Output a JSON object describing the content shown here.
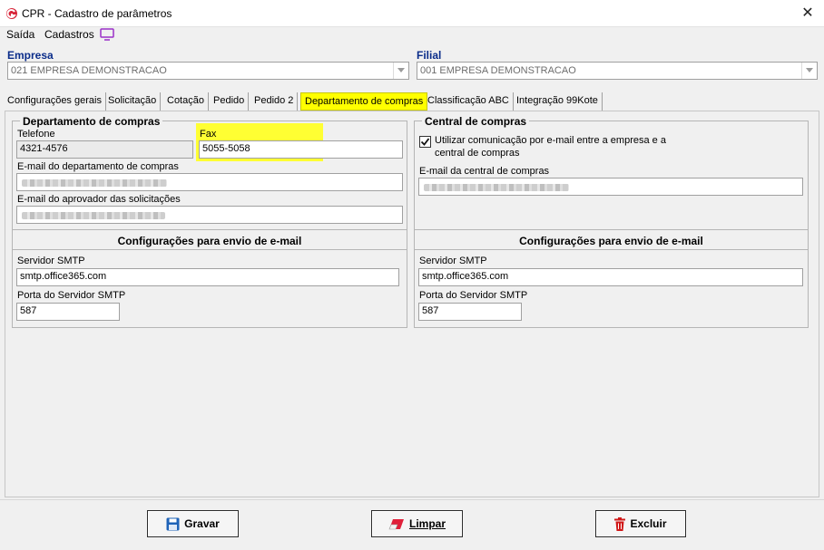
{
  "window": {
    "title": "CPR - Cadastro de parâmetros",
    "close_symbol": "✕"
  },
  "menu": {
    "items": [
      "Saída",
      "Cadastros"
    ]
  },
  "empresa": {
    "label": "Empresa",
    "value": "021 EMPRESA DEMONSTRACAO"
  },
  "filial": {
    "label": "Filial",
    "value": "001 EMPRESA DEMONSTRACAO"
  },
  "tabs": [
    "Configurações gerais",
    "Solicitação",
    "Cotação",
    "Pedido",
    "Pedido 2",
    "Departamento de compras",
    "Classificação ABC",
    "Integração 99Kote"
  ],
  "active_tab_index": 5,
  "departamento": {
    "title": "Departamento de compras",
    "telefone_label": "Telefone",
    "telefone_value": "4321-4576",
    "fax_label": "Fax",
    "fax_value": "5055-5058",
    "email_label": "E-mail do departamento de compras",
    "aprovador_label": "E-mail do aprovador das solicitações",
    "smtp_heading": "Configurações para envio de e-mail",
    "smtp_server_label": "Servidor SMTP",
    "smtp_server_value": "smtp.office365.com",
    "smtp_port_label": "Porta do Servidor SMTP",
    "smtp_port_value": "587"
  },
  "central": {
    "title": "Central de compras",
    "checkbox_label_line1": "Utilizar comunicação por e-mail entre a empresa e a",
    "checkbox_label_line2": "central de compras",
    "checkbox_checked": true,
    "email_label": "E-mail da central de compras",
    "smtp_heading": "Configurações para envio de e-mail",
    "smtp_server_label": "Servidor SMTP",
    "smtp_server_value": "smtp.office365.com",
    "smtp_port_label": "Porta do Servidor SMTP",
    "smtp_port_value": "587"
  },
  "buttons": {
    "gravar": "Gravar",
    "limpar": "Limpar",
    "excluir": "Excluir"
  },
  "colors": {
    "highlight": "#ffff00",
    "group_label": "#0b2d8a",
    "save_icon": "#1e63b8",
    "trash_icon": "#d01818",
    "eraser_icon": "#e0203a"
  },
  "icons": {
    "app": "app-logo-icon",
    "monitor": "monitor-icon",
    "save": "floppy-disk-icon",
    "clear": "eraser-icon",
    "delete": "trash-icon",
    "check": "checkmark-icon",
    "dropdown": "chevron-down-icon"
  }
}
